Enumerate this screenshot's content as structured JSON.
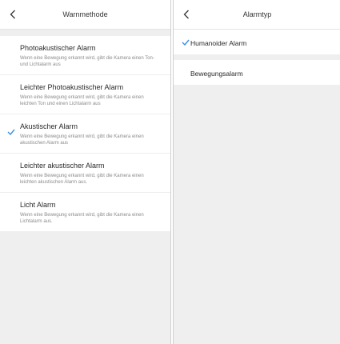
{
  "left": {
    "title": "Warnmethode",
    "items": [
      {
        "title": "Photoakustischer Alarm",
        "desc": "Wenn eine Bewegung erkannt wird, gibt die Kamera einen Ton- und Lichtalarm aus",
        "selected": false
      },
      {
        "title": "Leichter Photoakustischer Alarm",
        "desc": "Wenn eine Bewegung erkannt wird, gibt die Kamera einen leichten Ton und einen Lichtalarm aus",
        "selected": false
      },
      {
        "title": "Akustischer Alarm",
        "desc": "Wenn eine Bewegung erkannt wird, gibt die Kamera einen akustischen Alarm aus",
        "selected": true
      },
      {
        "title": "Leichter akustischer Alarm",
        "desc": "Wenn eine Bewegung erkannt wird, gibt die Kamera einen leichten akustischen Alarm aus.",
        "selected": false
      },
      {
        "title": "Licht Alarm",
        "desc": "Wenn eine Bewegung erkannt wird, gibt die Kamera einen Lichtalarm aus.",
        "selected": false
      }
    ]
  },
  "right": {
    "title": "Alarmtyp",
    "items": [
      {
        "title": "Humanoider Alarm",
        "selected": true
      },
      {
        "title": "Bewegungsalarm",
        "selected": false
      }
    ]
  },
  "icons": {
    "back": "chevron-left-icon",
    "check": "check-icon"
  },
  "colors": {
    "accent": "#3d8fe0",
    "background": "#efefef"
  }
}
